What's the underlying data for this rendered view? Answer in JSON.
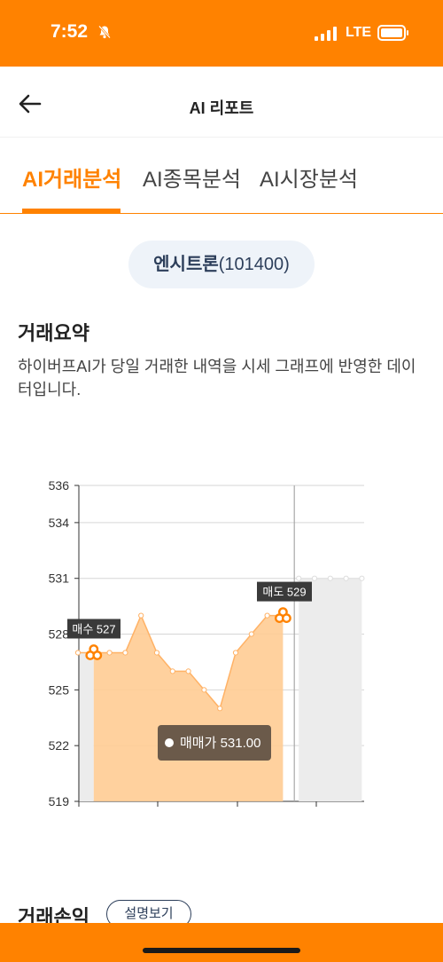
{
  "status_bar": {
    "time": "7:52",
    "network": "LTE",
    "bell_icon": "bell-slash-icon",
    "signal_icon": "signal-bars-icon",
    "battery_icon": "battery-icon"
  },
  "nav": {
    "title": "AI 리포트",
    "back_icon": "arrow-left-icon"
  },
  "tabs": [
    {
      "label": "AI거래분석",
      "active": true
    },
    {
      "label": "AI종목분석",
      "active": false
    },
    {
      "label": "AI시장분석",
      "active": false
    }
  ],
  "stock": {
    "name": "엔시트론",
    "code": "(101400)"
  },
  "summary": {
    "title": "거래요약",
    "description": "하이버프AI가 당일 거래한 내역을 시세 그래프에 반영한 데이터입니다."
  },
  "chart_data": {
    "type": "area",
    "y_ticks": [
      519,
      522,
      525,
      528,
      531,
      534,
      536
    ],
    "ylim": [
      519,
      536
    ],
    "y_axis_label_note": "",
    "series": [
      {
        "values": [
          527,
          527,
          527,
          527,
          529,
          527,
          526,
          526,
          525,
          524,
          527,
          528,
          529,
          529,
          531,
          531,
          531,
          531,
          531
        ]
      }
    ],
    "buy_index": 1,
    "sell_index": 13,
    "now_index": 14,
    "buy_label": "매수 527",
    "sell_label": "매도 529",
    "tooltip": "매매가 531.00",
    "colors": {
      "fill": "#ffcc94",
      "line": "#ffb266",
      "future_fill": "#ececec",
      "accent": "#ff8200"
    }
  },
  "pnl": {
    "title": "거래손익",
    "explain_label": "설명보기"
  }
}
